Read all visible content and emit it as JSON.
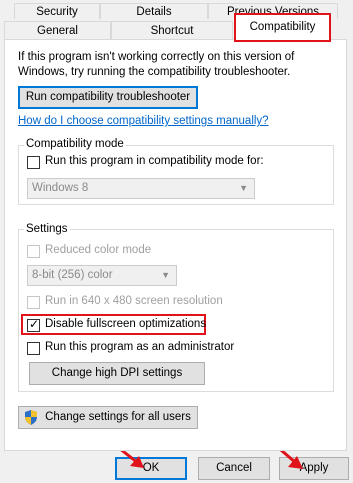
{
  "tabs": {
    "row1": [
      "Security",
      "Details",
      "Previous Versions"
    ],
    "row2": [
      "General",
      "Shortcut",
      "Compatibility"
    ]
  },
  "intro_text": "If this program isn't working correctly on this version of Windows, try running the compatibility troubleshooter.",
  "troubleshooter_button": "Run compatibility troubleshooter",
  "manual_link": "How do I choose compatibility settings manually?",
  "compat_mode": {
    "group_label": "Compatibility mode",
    "checkbox_label": "Run this program in compatibility mode for:",
    "checked": false,
    "select_value": "Windows 8"
  },
  "settings": {
    "group_label": "Settings",
    "reduced_color": {
      "label": "Reduced color mode",
      "checked": false,
      "enabled": false
    },
    "color_select": "8-bit (256) color",
    "resolution": {
      "label": "Run in 640 x 480 screen resolution",
      "checked": false,
      "enabled": false
    },
    "fullscreen": {
      "label": "Disable fullscreen optimizations",
      "checked": true,
      "check_mark": "✓"
    },
    "admin": {
      "label": "Run this program as an administrator",
      "checked": false
    },
    "dpi_button": "Change high DPI settings"
  },
  "all_users_button": "Change settings for all users",
  "footer": {
    "ok": "OK",
    "cancel": "Cancel",
    "apply": "Apply"
  },
  "colors": {
    "highlight": "#e0121a",
    "link": "#0066cc",
    "focus": "#0078d7"
  },
  "icons": {
    "shield": "uac-shield-icon",
    "pointer": "red-arrow-icon"
  }
}
